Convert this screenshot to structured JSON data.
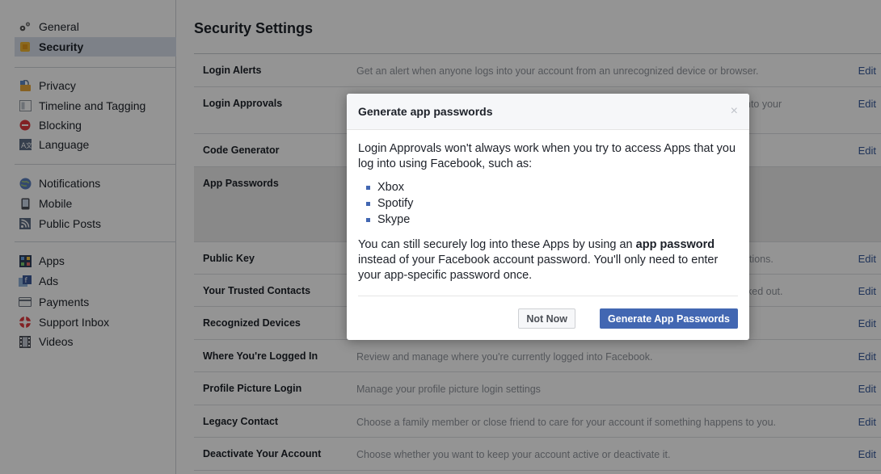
{
  "sidebar": {
    "items": [
      {
        "label": "General",
        "icon": "gears-icon"
      },
      {
        "label": "Security",
        "icon": "shield-icon",
        "active": true
      },
      {
        "label": "Privacy",
        "icon": "lock-icon"
      },
      {
        "label": "Timeline and Tagging",
        "icon": "timeline-icon"
      },
      {
        "label": "Blocking",
        "icon": "block-icon"
      },
      {
        "label": "Language",
        "icon": "language-icon"
      },
      {
        "label": "Notifications",
        "icon": "globe-icon"
      },
      {
        "label": "Mobile",
        "icon": "phone-icon"
      },
      {
        "label": "Public Posts",
        "icon": "rss-icon"
      },
      {
        "label": "Apps",
        "icon": "apps-icon"
      },
      {
        "label": "Ads",
        "icon": "ads-icon"
      },
      {
        "label": "Payments",
        "icon": "card-icon"
      },
      {
        "label": "Support Inbox",
        "icon": "lifebuoy-icon"
      },
      {
        "label": "Videos",
        "icon": "film-icon"
      }
    ]
  },
  "main": {
    "title": "Security Settings",
    "edit_label": "Edit",
    "rows": [
      {
        "label": "Login Alerts",
        "desc": "Get an alert when anyone logs into your account from an unrecognized device or browser."
      },
      {
        "label": "Login Approvals",
        "desc": "nto your"
      },
      {
        "label": "Code Generator",
        "desc": ""
      },
      {
        "label": "App Passwords",
        "desc": ""
      },
      {
        "label": "Public Key",
        "desc": "ations."
      },
      {
        "label": "Your Trusted Contacts",
        "desc": "ked out."
      },
      {
        "label": "Recognized Devices",
        "desc": ""
      },
      {
        "label": "Where You're Logged In",
        "desc": "Review and manage where you're currently logged into Facebook."
      },
      {
        "label": "Profile Picture Login",
        "desc": "Manage your profile picture login settings"
      },
      {
        "label": "Legacy Contact",
        "desc": "Choose a family member or close friend to care for your account if something happens to you."
      },
      {
        "label": "Deactivate Your Account",
        "desc": "Choose whether you want to keep your account active or deactivate it."
      }
    ]
  },
  "dialog": {
    "title": "Generate app passwords",
    "close": "×",
    "intro": "Login Approvals won't always work when you try to access Apps that you log into using Facebook, such as:",
    "apps": [
      "Xbox",
      "Spotify",
      "Skype"
    ],
    "para_a": "You can still securely log into these Apps by using an ",
    "para_bold_1": "app password",
    "para_b": " instead of your Facebook account password. You'll only need to enter your app-specific password once.",
    "cancel_label": "Not Now",
    "confirm_label": "Generate App Passwords"
  },
  "colors": {
    "accent": "#4267b2",
    "link": "#365899",
    "overlay": "rgba(0,0,0,0.42)"
  }
}
